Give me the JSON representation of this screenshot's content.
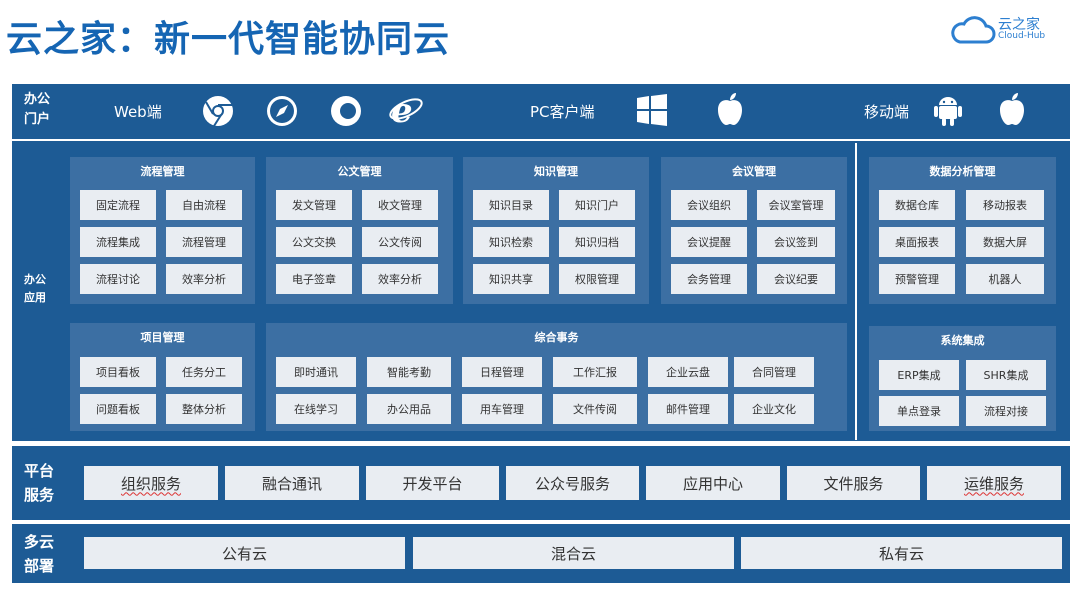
{
  "title": "云之家：新一代智能协同云",
  "logo": {
    "cn": "云之家",
    "en": "Cloud-Hub"
  },
  "portal": {
    "label_1": "办公",
    "label_2": "门户",
    "web_label": "Web端",
    "pc_label": "PC客户端",
    "mobile_label": "移动端",
    "icons": [
      "chrome-icon",
      "safari-icon",
      "firefox-icon",
      "ie-icon",
      "windows-icon",
      "apple-icon",
      "android-icon",
      "apple-icon"
    ]
  },
  "apps": {
    "label_1": "办公",
    "label_2": "应用",
    "process": {
      "title": "流程管理",
      "items": [
        "固定流程",
        "自由流程",
        "流程集成",
        "流程管理",
        "流程讨论",
        "效率分析"
      ]
    },
    "document": {
      "title": "公文管理",
      "items": [
        "发文管理",
        "收文管理",
        "公文交换",
        "公文传阅",
        "电子签章",
        "效率分析"
      ]
    },
    "knowledge": {
      "title": "知识管理",
      "items": [
        "知识目录",
        "知识门户",
        "知识检索",
        "知识归档",
        "知识共享",
        "权限管理"
      ]
    },
    "meeting": {
      "title": "会议管理",
      "items": [
        "会议组织",
        "会议室管理",
        "会议提醒",
        "会议签到",
        "会务管理",
        "会议纪要"
      ]
    },
    "analysis": {
      "title": "数据分析管理",
      "items": [
        "数据仓库",
        "移动报表",
        "桌面报表",
        "数据大屏",
        "预警管理",
        "机器人"
      ]
    },
    "project": {
      "title": "项目管理",
      "items": [
        "项目看板",
        "任务分工",
        "问题看板",
        "整体分析"
      ]
    },
    "affairs": {
      "title": "综合事务",
      "items": [
        "即时通讯",
        "智能考勤",
        "日程管理",
        "工作汇报",
        "企业云盘",
        "合同管理",
        "在线学习",
        "办公用品",
        "用车管理",
        "文件传阅",
        "邮件管理",
        "企业文化"
      ]
    },
    "integration": {
      "title": "系统集成",
      "items": [
        "ERP集成",
        "SHR集成",
        "单点登录",
        "流程对接"
      ]
    }
  },
  "platform": {
    "label_1": "平台",
    "label_2": "服务",
    "items": [
      "组织服务",
      "融合通讯",
      "开发平台",
      "公众号服务",
      "应用中心",
      "文件服务",
      "运维服务"
    ]
  },
  "cloud": {
    "label_1": "多云",
    "label_2": "部署",
    "items": [
      "公有云",
      "混合云",
      "私有云"
    ]
  },
  "colors": {
    "band": "#1d5b95",
    "panel": "#3c6fa3",
    "box": "#e9edf2",
    "title": "#1565b3"
  }
}
